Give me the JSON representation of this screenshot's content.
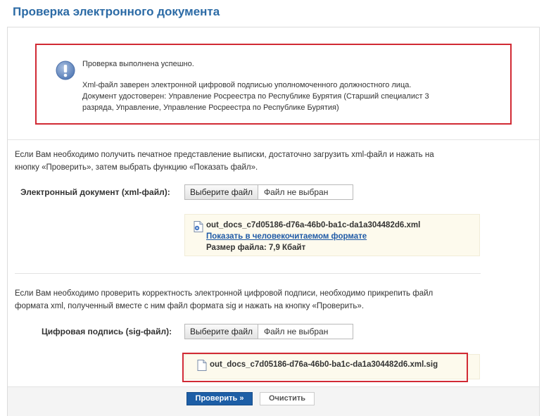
{
  "page": {
    "title": "Проверка электронного документа"
  },
  "result": {
    "status": "Проверка выполнена успешно.",
    "line1": "Xml-файл заверен электронной цифровой подписью уполномоченного должностного лица.",
    "line2": "Документ удостоверен: Управление Росреестра по Республике Бурятия (Старший специалист 3",
    "line3": "разряда, Управление, Управление Росреестра по Республике Бурятия)",
    "icon": "info-icon",
    "border_color": "#d12a34"
  },
  "xml_section": {
    "instruction_line1": "Если Вам необходимо получить печатное представление выписки, достаточно загрузить xml-файл и нажать на",
    "instruction_line2": "кнопку «Проверить», затем выбрать функцию «Показать файл».",
    "label": "Электронный документ (xml-файл):",
    "choose_button": "Выберите файл",
    "no_file": "Файл не выбран",
    "file_name": "out_docs_c7d05186-d76a-46b0-ba1c-da1a304482d6.xml",
    "show_link": "Показать в человекочитаемом формате",
    "file_size": "Размер файла: 7,9 Кбайт",
    "file_icon": "xml-document-icon"
  },
  "sig_section": {
    "instruction_line1": "Если Вам необходимо проверить корректность электронной цифровой подписи, необходимо прикрепить файл",
    "instruction_line2": "формата xml, полученный вместе с ним файл формата sig и нажать на кнопку «Проверить».",
    "label": "Цифровая подпись (sig-файл):",
    "choose_button": "Выберите файл",
    "no_file": "Файл не выбран",
    "file_name": "out_docs_c7d05186-d76a-46b0-ba1c-da1a304482d6.xml.sig",
    "file_icon": "document-icon"
  },
  "actions": {
    "check": "Проверить »",
    "clear": "Очистить",
    "primary_color": "#1d5ea6"
  }
}
